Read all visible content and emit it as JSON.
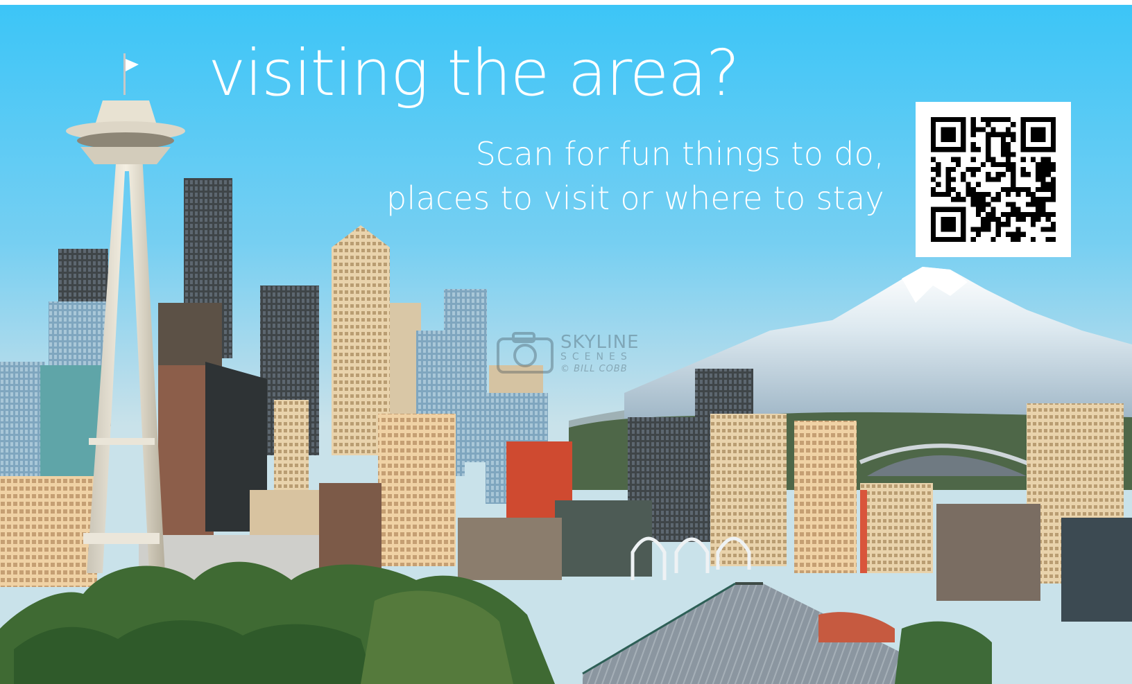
{
  "headline": "visiting the area?",
  "subline": {
    "line1": "Scan for fun things to do,",
    "line2": "places to visit or where to stay"
  },
  "watermark": {
    "line1": "SKYLINE",
    "line2": "SCENES",
    "line3": "© BILL COBB"
  },
  "icons": {
    "qr": "qr-code-icon",
    "watermark": "camera-icon"
  },
  "colors": {
    "sky_top": "#3fc6f6",
    "sky_bottom": "#cfe7f0",
    "text": "#ffffff"
  }
}
